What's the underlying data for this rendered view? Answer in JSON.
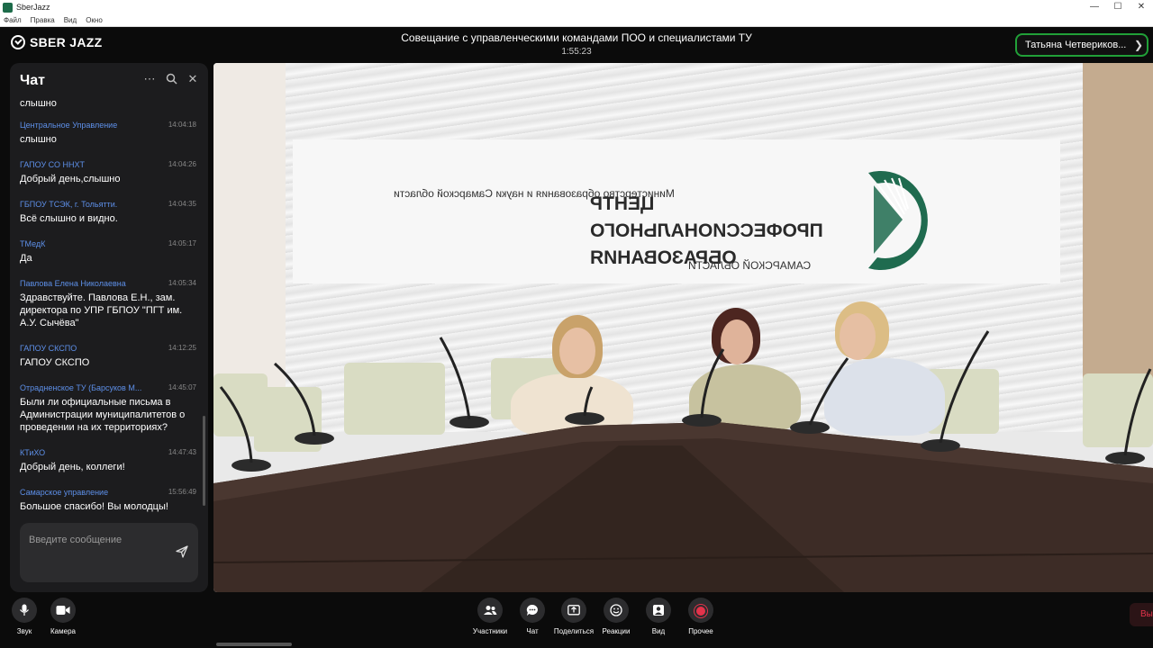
{
  "os": {
    "window_title": "SberJazz",
    "menu": [
      "Файл",
      "Правка",
      "Вид",
      "Окно"
    ],
    "minimize": "—",
    "maximize": "☐",
    "close": "✕"
  },
  "header": {
    "logo_text": "SBER JAZZ",
    "meeting_title": "Совещание с управленческими командами ПОО и специалистами ТУ",
    "timer": "1:55:23",
    "user_name": "Татьяна Четвериков...",
    "user_chevron": "❯"
  },
  "chat": {
    "title": "Чат",
    "more_icon": "⋯",
    "search_icon": "⌕",
    "close_icon": "✕",
    "messages": [
      {
        "author": "",
        "time": "",
        "text": "слышно"
      },
      {
        "author": "Центральное Управление",
        "time": "14:04:18",
        "text": "слышно"
      },
      {
        "author": "ГАПОУ СО ННХТ",
        "time": "14:04:26",
        "text": "Добрый день,слышно"
      },
      {
        "author": "ГБПОУ ТСЭК, г. Тольятти.",
        "time": "14:04:35",
        "text": "Всё слышно и видно."
      },
      {
        "author": "ТМедК",
        "time": "14:05:17",
        "text": "Да"
      },
      {
        "author": "Павлова Елена Николаевна",
        "time": "14:05:34",
        "text": "Здравствуйте. Павлова Е.Н., зам. директора по УПР ГБПОУ \"ПГТ им. А.У. Сычёва\""
      },
      {
        "author": "ГАПОУ СКСПО",
        "time": "14:12:25",
        "text": "ГАПОУ СКСПО"
      },
      {
        "author": "Отрадненское ТУ (Барсуков М...",
        "time": "14:45:07",
        "text": "Были ли официальные письма в Администрации муниципалитетов о проведении на их территориях?"
      },
      {
        "author": "КТиХО",
        "time": "14:47:43",
        "text": "Добрый день, коллеги!"
      },
      {
        "author": "Самарское управление",
        "time": "15:56:49",
        "text": "Большое спасибо! Вы молодцы!"
      }
    ],
    "input_placeholder": "Введите сообщение"
  },
  "video": {
    "banner_ministry": "Министерство образования и науки Самарской области",
    "banner_line1": "ЦЕНТР",
    "banner_line2": "ПРОФЕССИОНАЛЬНОГО",
    "banner_line3": "ОБРАЗОВАНИЯ",
    "banner_region": "САМАРСКОЙ ОБЛАСТИ"
  },
  "controls": {
    "left": [
      {
        "label": "Звук",
        "icon": "microphone-icon"
      },
      {
        "label": "Камера",
        "icon": "camera-icon"
      }
    ],
    "center": [
      {
        "label": "Участники",
        "icon": "participants-icon"
      },
      {
        "label": "Чат",
        "icon": "chat-icon"
      },
      {
        "label": "Поделиться",
        "icon": "share-icon"
      },
      {
        "label": "Реакции",
        "icon": "reactions-icon"
      },
      {
        "label": "Вид",
        "icon": "view-icon"
      },
      {
        "label": "Прочее",
        "icon": "record-icon"
      }
    ],
    "leave_label": "Вы"
  },
  "colors": {
    "accent_green": "#21a038",
    "author_blue": "#5d8fe8",
    "record_red": "#e4334b",
    "emblem_green": "#1f6b4f"
  }
}
